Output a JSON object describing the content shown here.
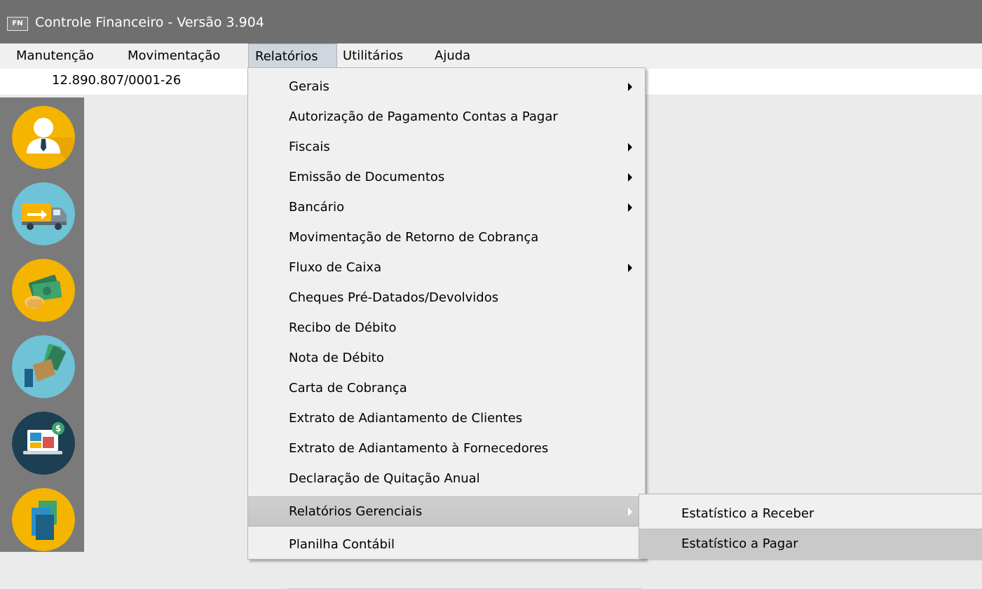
{
  "window": {
    "icon_text": "FN",
    "title": "Controle Financeiro - Versão 3.904"
  },
  "menubar": {
    "items": [
      {
        "label": "Manutenção",
        "active": false
      },
      {
        "label": "Movimentação",
        "active": false
      },
      {
        "label": "Relatórios",
        "active": true
      },
      {
        "label": "Utilitários",
        "active": false
      },
      {
        "label": "Ajuda",
        "active": false
      }
    ]
  },
  "company": {
    "cnpj": "12.890.807/0001-26"
  },
  "sidebar": {
    "buttons": [
      {
        "icon": "user-icon",
        "color": "#f4b400"
      },
      {
        "icon": "truck-icon",
        "color": "#6ec3d6"
      },
      {
        "icon": "money-icon",
        "color": "#f4b400"
      },
      {
        "icon": "payment-icon",
        "color": "#6ec3d6"
      },
      {
        "icon": "laptop-icon",
        "color": "#1c3f53"
      },
      {
        "icon": "documents-icon",
        "color": "#f4b400"
      }
    ]
  },
  "relatorios_menu": {
    "items": [
      {
        "label": "Gerais",
        "has_submenu": true
      },
      {
        "label": "Autorização de Pagamento Contas a Pagar",
        "has_submenu": false
      },
      {
        "label": "Fiscais",
        "has_submenu": true
      },
      {
        "label": "Emissão de Documentos",
        "has_submenu": true
      },
      {
        "label": "Bancário",
        "has_submenu": true
      },
      {
        "label": "Movimentação de Retorno de Cobrança",
        "has_submenu": false
      },
      {
        "label": "Fluxo de Caixa",
        "has_submenu": true
      },
      {
        "label": "Cheques Pré-Datados/Devolvidos",
        "has_submenu": false
      },
      {
        "label": "Recibo de Débito",
        "has_submenu": false
      },
      {
        "label": "Nota de Débito",
        "has_submenu": false
      },
      {
        "label": "Carta de Cobrança",
        "has_submenu": false
      },
      {
        "label": "Extrato de Adiantamento de Clientes",
        "has_submenu": false
      },
      {
        "label": "Extrato de Adiantamento à Fornecedores",
        "has_submenu": false
      },
      {
        "label": "Declaração de Quitação Anual",
        "has_submenu": false
      },
      {
        "label": "Relatórios Gerenciais",
        "has_submenu": true,
        "highlighted": true
      },
      {
        "label": "Planilha Contábil",
        "has_submenu": false
      }
    ]
  },
  "gerenciais_submenu": {
    "items": [
      {
        "label": "Estatístico a Receber",
        "highlighted": false
      },
      {
        "label": "Estatístico a Pagar",
        "highlighted": true
      }
    ]
  },
  "colors": {
    "titlebar": "#6f6f6f",
    "menubar": "#f0f0f0",
    "highlight": "#c9c9c9",
    "sidebar": "#7a7a7a"
  }
}
